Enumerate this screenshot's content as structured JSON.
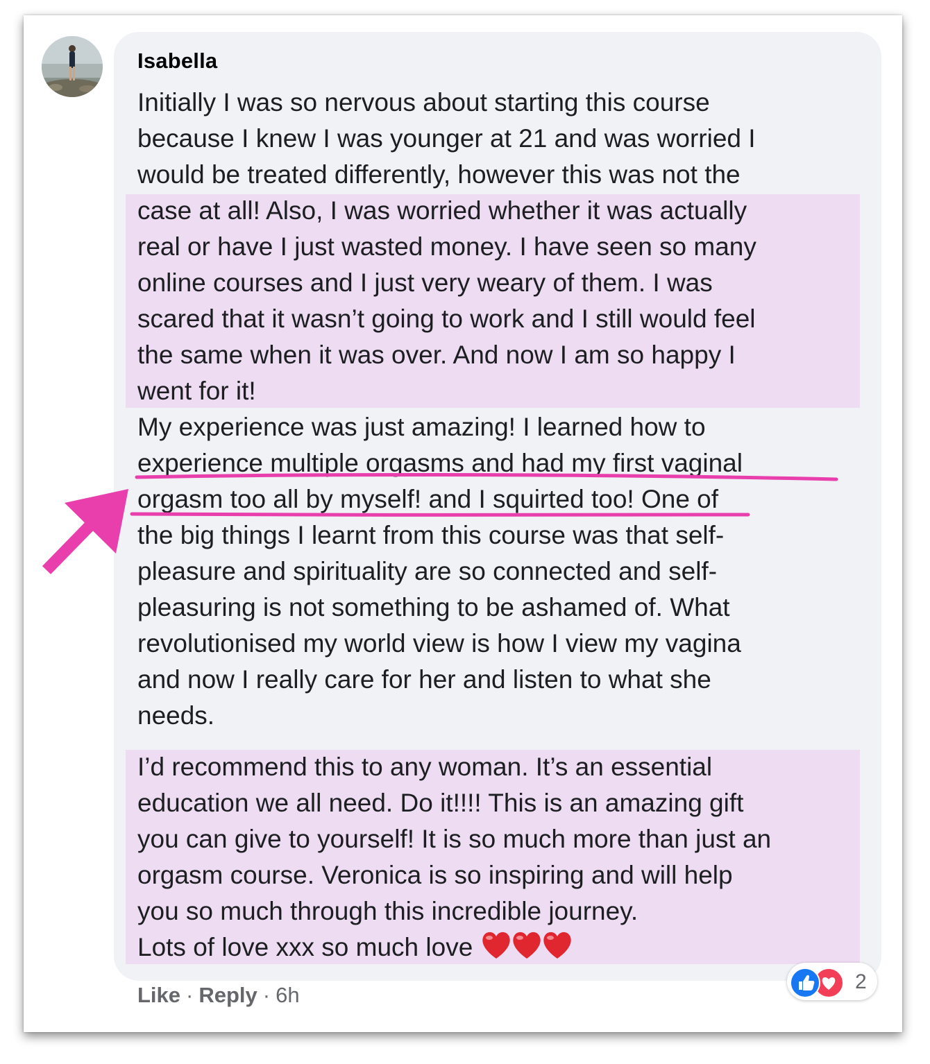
{
  "comment": {
    "author": "Isabella",
    "lines_part1": [
      "Initially I was so nervous about starting this course",
      "because I knew I was younger at 21 and was worried I",
      "would be treated differently, however this was not the",
      "case at all! Also, I was worried whether it was actually",
      "real or have I just wasted money. I have seen so many",
      "online courses and I just very weary of them. I was",
      "scared that it wasn’t going to work and I still would feel",
      "the same when it was over. And now I am so happy I",
      "went for it!",
      "My experience was just amazing! I learned how to",
      "experience multiple orgasms and had my first vaginal",
      "orgasm too all by myself! and I squirted too! One of",
      "the big things I learnt from this course was that self-",
      "pleasure and spirituality are so connected and self-",
      "pleasuring is not something to be ashamed of. What",
      "revolutionised my world view is how I view my vagina",
      "and now I really care for her and listen to what she",
      "needs."
    ],
    "lines_part2": [
      "I’d recommend this to any woman. It’s an essential",
      "education we all need. Do it!!!! This is an amazing gift",
      "you can give to yourself! It is so much more than just an",
      "orgasm course. Veronica is so inspiring and will help",
      "you so much through this incredible journey.",
      "Lots of love xxx so much love"
    ],
    "emoji": [
      "red-heart",
      "red-heart",
      "red-heart"
    ]
  },
  "actions": {
    "like_label": "Like",
    "separator": "·",
    "reply_label": "Reply",
    "time": "6h"
  },
  "reactions": {
    "icons": [
      "like-icon",
      "love-icon"
    ],
    "count": "2"
  },
  "colors": {
    "highlight": "#eedcf2",
    "annotation_pink": "#e83fad",
    "bubble": "#f0f2f5",
    "like_blue": "#1877f2",
    "love_red": "#f33e58"
  }
}
